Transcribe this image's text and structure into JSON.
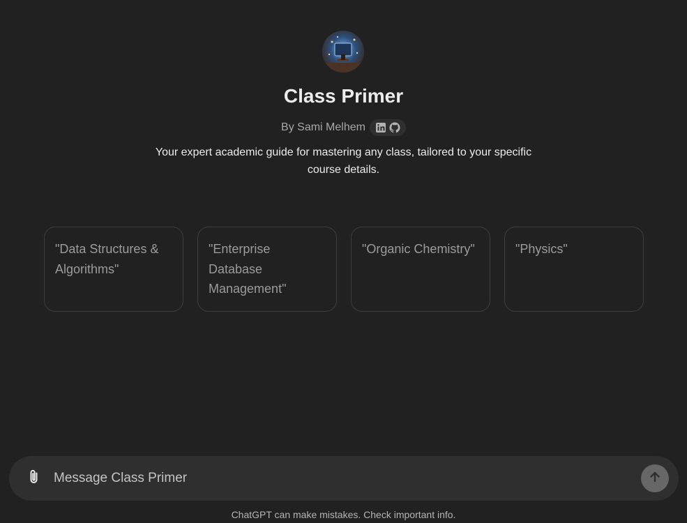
{
  "gpt": {
    "name": "Class Primer",
    "byline": "By Sami Melhem",
    "description": "Your expert academic guide for mastering any class, tailored to your specific course details."
  },
  "social_icons": [
    "linkedin-icon",
    "github-icon"
  ],
  "conversation_starters": [
    "\"Data Structures & Algorithms\"",
    "\"Enterprise Database Management\"",
    "\"Organic Chemistry\"",
    "\"Physics\""
  ],
  "composer": {
    "placeholder": "Message Class Primer",
    "attach_icon": "paperclip-icon",
    "send_icon": "arrow-up-icon"
  },
  "footer": {
    "disclaimer": "ChatGPT can make mistakes. Check important info."
  },
  "colors": {
    "background": "#212121",
    "composer": "#2f2f2f",
    "starter_border": "#3d3d3d",
    "send_button": "#676767"
  }
}
